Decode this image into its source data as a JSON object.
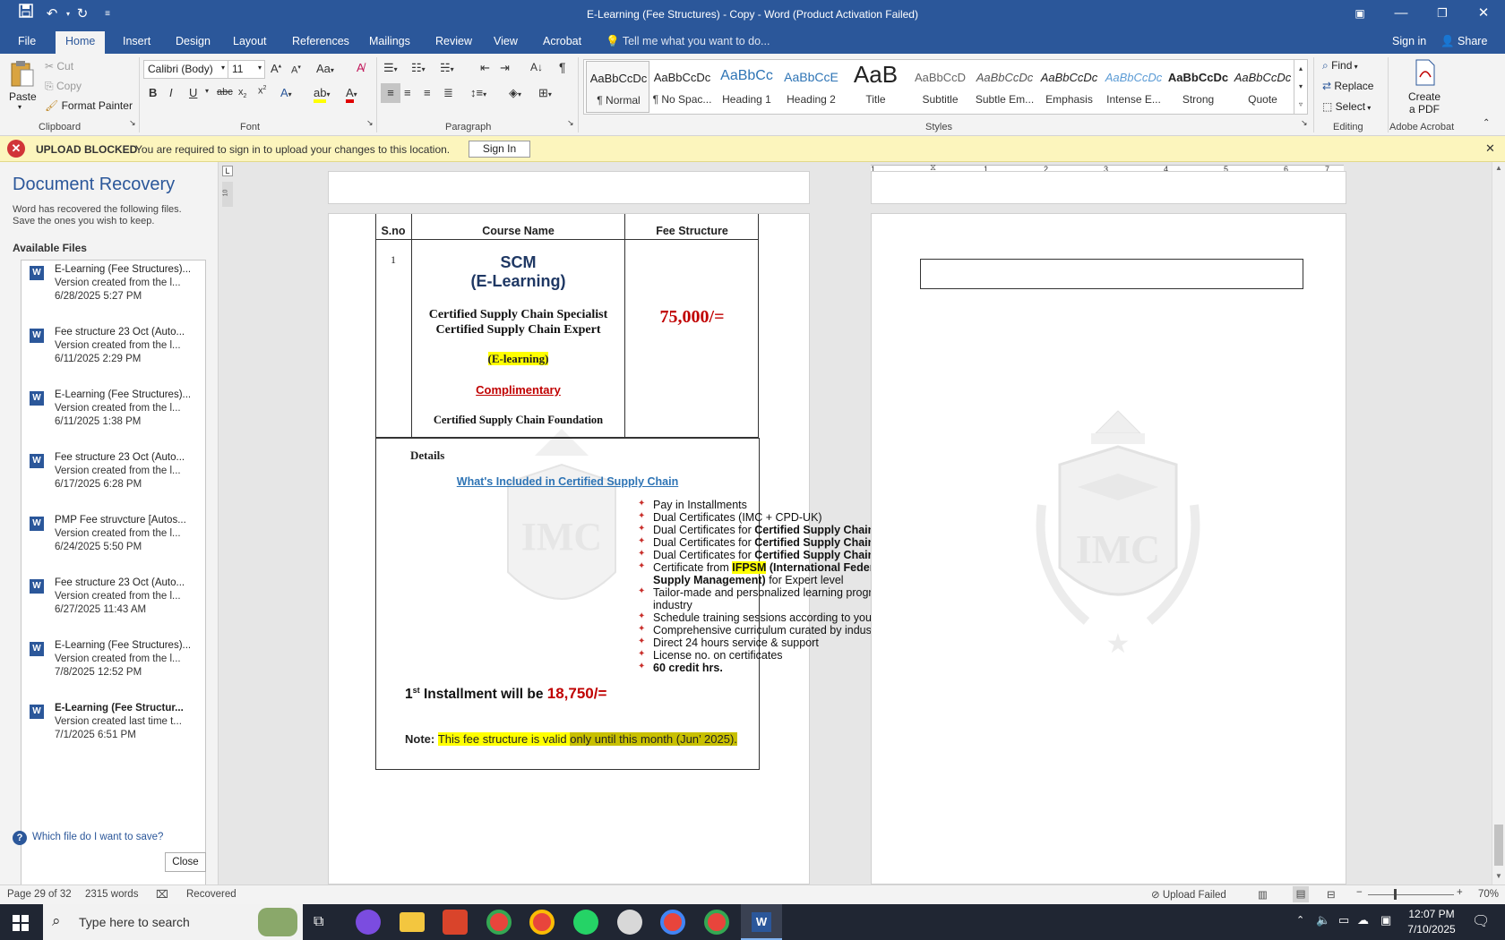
{
  "titlebar": {
    "title": "E-Learning (Fee Structures) - Copy - Word (Product Activation Failed)"
  },
  "tabs": [
    "File",
    "Home",
    "Insert",
    "Design",
    "Layout",
    "References",
    "Mailings",
    "Review",
    "View",
    "Acrobat"
  ],
  "tellme": "Tell me what you want to do...",
  "signin": "Sign in",
  "share": "Share",
  "clipboard": {
    "paste": "Paste",
    "cut": "Cut",
    "copy": "Copy",
    "format_painter": "Format Painter",
    "label": "Clipboard"
  },
  "font": {
    "name": "Calibri (Body)",
    "size": "11",
    "label": "Font"
  },
  "paragraph": {
    "label": "Paragraph"
  },
  "styles": {
    "label": "Styles",
    "items": [
      {
        "preview": "AaBbCcDc",
        "name": "¶ Normal"
      },
      {
        "preview": "AaBbCcDc",
        "name": "¶ No Spac..."
      },
      {
        "preview": "AaBbCc",
        "name": "Heading 1"
      },
      {
        "preview": "AaBbCcE",
        "name": "Heading 2"
      },
      {
        "preview": "AaB",
        "name": "Title"
      },
      {
        "preview": "AaBbCcD",
        "name": "Subtitle"
      },
      {
        "preview": "AaBbCcDc",
        "name": "Subtle Em..."
      },
      {
        "preview": "AaBbCcDc",
        "name": "Emphasis"
      },
      {
        "preview": "AaBbCcDc",
        "name": "Intense E..."
      },
      {
        "preview": "AaBbCcDc",
        "name": "Strong"
      },
      {
        "preview": "AaBbCcDc",
        "name": "Quote"
      }
    ]
  },
  "editing": {
    "find": "Find",
    "replace": "Replace",
    "select": "Select",
    "label": "Editing"
  },
  "acrobat": {
    "create_pdf_1": "Create",
    "create_pdf_2": "a PDF",
    "label": "Adobe Acrobat"
  },
  "msgbar": {
    "title": "UPLOAD BLOCKED",
    "text": "You are required to sign in to upload your changes to this location.",
    "button": "Sign In"
  },
  "recovery": {
    "title": "Document Recovery",
    "desc_1": "Word has recovered the following files.",
    "desc_2": "Save the ones you wish to keep.",
    "available": "Available Files",
    "files": [
      {
        "name": "E-Learning (Fee Structures)...",
        "desc": "Version created from the l...",
        "date": "6/28/2025 5:27 PM"
      },
      {
        "name": "Fee structure 23 Oct (Auto...",
        "desc": "Version created from the l...",
        "date": "6/11/2025 2:29 PM"
      },
      {
        "name": "E-Learning (Fee Structures)...",
        "desc": "Version created from the l...",
        "date": "6/11/2025 1:38 PM"
      },
      {
        "name": "Fee structure 23 Oct (Auto...",
        "desc": "Version created from the l...",
        "date": "6/17/2025 6:28 PM"
      },
      {
        "name": "PMP Fee struvcture  [Autos...",
        "desc": "Version created from the l...",
        "date": "6/24/2025 5:50 PM"
      },
      {
        "name": "Fee structure 23 Oct (Auto...",
        "desc": "Version created from the l...",
        "date": "6/27/2025 11:43 AM"
      },
      {
        "name": "E-Learning (Fee Structures)...",
        "desc": "Version created from the l...",
        "date": "7/8/2025 12:52 PM"
      },
      {
        "name": "E-Learning (Fee Structur...",
        "desc": "Version created last time t...",
        "date": "7/1/2025 6:51 PM"
      }
    ],
    "which": "Which file do I want to save?",
    "close": "Close"
  },
  "doc": {
    "col_sno": "S.no",
    "col_course": "Course Name",
    "col_fee": "Fee Structure",
    "row_no": "1",
    "scm": "SCM",
    "scm_sub": "(E-Learning)",
    "cert1": "Certified Supply Chain Specialist",
    "cert2": "Certified Supply Chain Expert",
    "elearning": "(E-learning)",
    "complimentary": "Complimentary",
    "foundation": "Certified Supply Chain Foundation",
    "fee": "75,000/=",
    "details": "Details",
    "included": "What's Included in Certified Supply Chain",
    "b1": "Pay in Installments",
    "b2": "Dual Certificates (IMC + CPD-UK)",
    "b3a": "Dual Certificates for ",
    "b3b": "Certified  Supply Chain Foundation",
    "b4a": "Dual Certificates for ",
    "b4b": "Certified  Supply Chain  Specialist",
    "b5a": "Dual Certificates for ",
    "b5b": "Certified  Supply Chain  Expert",
    "b6a": "Certificate from ",
    "b6b": "IFPSM",
    "b6c": " (International Federation of Purchasing and",
    "b6d": "Supply Management)",
    "b6e": " for Expert level",
    "b7a": "Tailor-made and personalized learning program according to current",
    "b7b": "industry",
    "b8": "Schedule training sessions according to your calendar",
    "b9": "Comprehensive curriculum curated by industry advisors",
    "b10": "Direct 24 hours service & support",
    "b11": "License no. on certificates",
    "b12": "60 credit hrs.",
    "inst_1": "1",
    "inst_sup": "st",
    "inst_2": " Installment will be ",
    "inst_amt": "18,750/=",
    "note_lbl": "Note: ",
    "note_1": "This fee structure is valid ",
    "note_2": "only until this month (Jun’ 2025).",
    "watermark": "IMC"
  },
  "ruler": [
    "1",
    "1",
    "2",
    "3",
    "4",
    "5",
    "6",
    "7"
  ],
  "vruler": "10",
  "status": {
    "page": "Page 29 of 32",
    "words": "2315 words",
    "recovered": "Recovered",
    "upload": "Upload Failed",
    "zoom": "70%"
  },
  "taskbar": {
    "search": "Type here to search",
    "time": "12:07 PM",
    "date": "7/10/2025"
  },
  "colors": {
    "accent": "#2b579a",
    "fee_red": "#c00000",
    "scm_navy": "#1f3864",
    "link_blue": "#2e74b5"
  }
}
